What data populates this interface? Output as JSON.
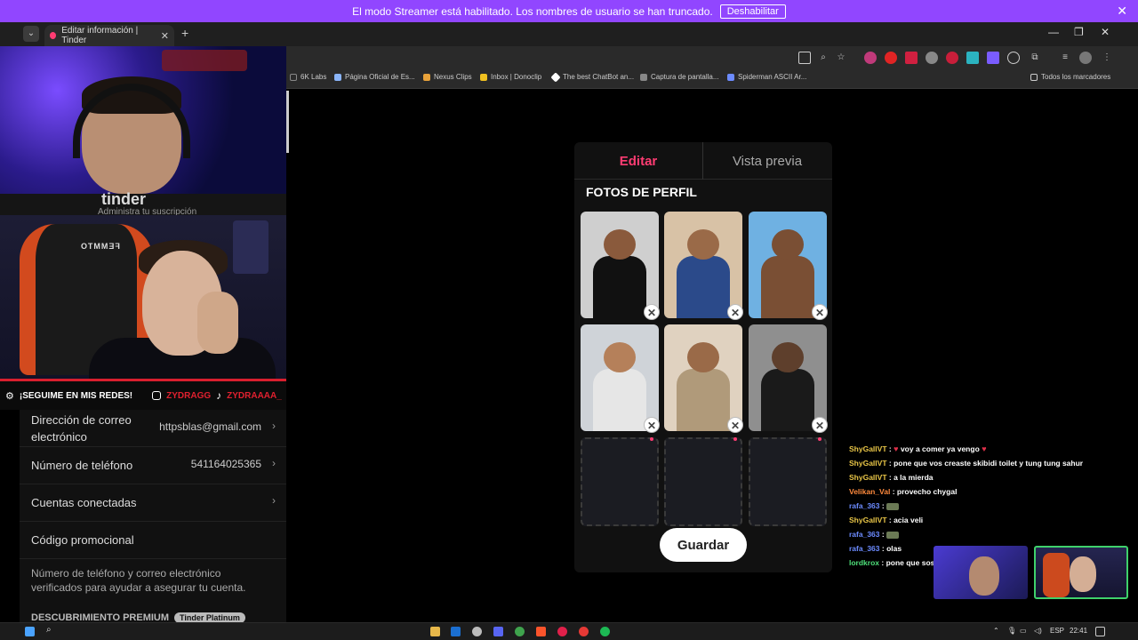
{
  "banner": {
    "message": "El modo Streamer está habilitado. Los nombres de usuario se han truncado.",
    "button": "Deshabilitar",
    "close_glyph": "✕"
  },
  "browser": {
    "tab_title": "Editar información | Tinder",
    "tab_close": "✕",
    "new_tab": "+",
    "tab_list_glyph": "⌄",
    "window_controls": {
      "minimize": "—",
      "restore": "❐",
      "close": "✕"
    },
    "toolbar_icons": [
      "cast-icon",
      "zoom-icon",
      "star-icon",
      "extension-icon",
      "puzzle-icon",
      "menu-icon"
    ],
    "bookmarks": [
      "6K Labs",
      "Página Oficial de Es...",
      "Nexus Clips",
      "Inbox | Donoclip",
      "The best ChatBot an...",
      "Captura de pantalla...",
      "Spiderman ASCII Ar..."
    ],
    "all_bookmarks": "Todos los marcadores"
  },
  "overlay": {
    "tinder_logo": "tinder",
    "tinder_sub": "Administra tu suscripción",
    "chair_logo": "FEMMTO",
    "social_text": "¡SEGUIME EN MIS REDES!",
    "social_instagram": "ZYDRAGG",
    "social_tiktok": "ZYDRAAAA_"
  },
  "settings": {
    "email_label_1": "Dirección de correo",
    "email_label_2": "electrónico",
    "email_value": "httpsblas@gmail.com",
    "phone_label": "Número de teléfono",
    "phone_value": "541164025365",
    "connected_label": "Cuentas conectadas",
    "promo_label": "Código promocional",
    "info_text": "Número de teléfono y correo electrónico verificados para ayudar a asegurar tu cuenta.",
    "premium_label": "DESCUBRIMIENTO PREMIUM",
    "premium_pill": "Tinder Platinum",
    "chevron": "›"
  },
  "editor": {
    "tab_edit": "Editar",
    "tab_preview": "Vista previa",
    "section_title": "FOTOS DE PERFIL",
    "remove_glyph": "✕",
    "photos": [
      {
        "bg": "#cfcfcf",
        "skin": "#8a5a3c",
        "shirt": "#111111"
      },
      {
        "bg": "#d8c2a6",
        "skin": "#9a6a48",
        "shirt": "#2b4a8a"
      },
      {
        "bg": "#6fb1e2",
        "skin": "#7a4f34",
        "shirt": "#7a4f34"
      },
      {
        "bg": "#cfd3d8",
        "skin": "#b5805a",
        "shirt": "#e6e6e6"
      },
      {
        "bg": "#e0d2c0",
        "skin": "#9a6a48",
        "shirt": "#b09a7a"
      },
      {
        "bg": "#8f8f8f",
        "skin": "#5e3f2c",
        "shirt": "#1a1a1a"
      }
    ],
    "save_button": "Guardar"
  },
  "chat": {
    "colors": {
      "yellow": "#e8c547",
      "orange": "#ff8a3d",
      "blue": "#6c8bff",
      "green": "#4ee07a"
    },
    "messages": [
      {
        "user": "ShyGallVT",
        "color": "#e8c547",
        "text": "voy a comer ya vengo",
        "hearts": true
      },
      {
        "user": "ShyGallVT",
        "color": "#e8c547",
        "text": "pone que vos creaste skibidi toilet y tung tung sahur"
      },
      {
        "user": "ShyGallVT",
        "color": "#e8c547",
        "text": "a la mierda"
      },
      {
        "user": "Velikan_Val",
        "color": "#ff8a3d",
        "text": "provecho chygal"
      },
      {
        "user": "rafa_363",
        "color": "#6c8bff",
        "text": "",
        "emote": true
      },
      {
        "user": "ShyGallVT",
        "color": "#e8c547",
        "text": "acia veli"
      },
      {
        "user": "rafa_363",
        "color": "#6c8bff",
        "text": "",
        "emote": true
      },
      {
        "user": "rafa_363",
        "color": "#6c8bff",
        "text": "olas"
      },
      {
        "user": "lordkrox",
        "color": "#4ee07a",
        "text": "pone que sos fanatico de hello kyti"
      }
    ]
  },
  "taskbar": {
    "lang": "ESP",
    "time": "22:41"
  }
}
